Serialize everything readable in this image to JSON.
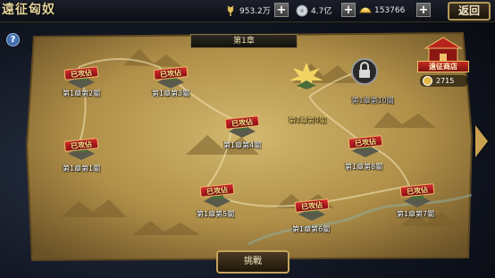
{
  "window": {
    "title": "遠征匈奴",
    "back_label": "返回"
  },
  "resources": [
    {
      "icon": "wheat-icon",
      "value": "953.2万"
    },
    {
      "icon": "silver-coin-icon",
      "value": "4.7亿"
    },
    {
      "icon": "gold-ingot-icon",
      "value": "153766"
    }
  ],
  "map": {
    "chapter_title": "第1章",
    "cleared_label": "已攻佔",
    "stages": [
      {
        "label": "第1章第1關",
        "status": "cleared"
      },
      {
        "label": "第1章第2關",
        "status": "cleared"
      },
      {
        "label": "第1章第3關",
        "status": "cleared"
      },
      {
        "label": "第1章第4關",
        "status": "cleared"
      },
      {
        "label": "第1章第5關",
        "status": "cleared"
      },
      {
        "label": "第1章第6關",
        "status": "cleared"
      },
      {
        "label": "第1章第7關",
        "status": "cleared"
      },
      {
        "label": "第1章第8關",
        "status": "cleared"
      },
      {
        "label": "第1章第9關",
        "status": "current"
      },
      {
        "label": "第1章第10關",
        "status": "locked"
      }
    ]
  },
  "shop": {
    "label": "遠征商店",
    "currency_value": "2715"
  },
  "actions": {
    "challenge_label": "挑戰",
    "help_label": "?"
  },
  "colors": {
    "accent_gold": "#c9a050",
    "cleared_red": "#c52a21",
    "current_label": "#f1d66b"
  }
}
